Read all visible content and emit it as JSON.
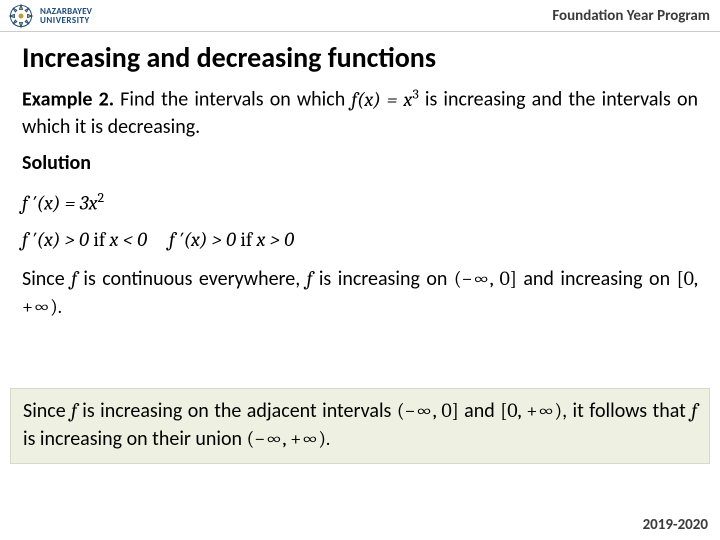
{
  "header": {
    "logo_line1": "NAZARBAYEV",
    "logo_line2": "UNIVERSITY",
    "program": "Foundation Year Program"
  },
  "title": "Increasing and decreasing functions",
  "example": {
    "label": "Example 2.",
    "text_before": " Find the intervals on which ",
    "fx_eq": "f(x) = x",
    "exp": "3",
    "text_after": " is increasing and the intervals on which it is decreasing."
  },
  "solution_label": "Solution",
  "derivative": {
    "lhs": "f ′(x) = 3x",
    "exp": "2"
  },
  "signs": {
    "p1a": "f ′(x) > 0",
    "if1": " if ",
    "p1b": "x < 0",
    "p2a": "f ′(x) > 0",
    "if2": " if ",
    "p2b": "x > 0"
  },
  "since1": {
    "a": "Since ",
    "f1": "f",
    "b": " is continuous everywhere, ",
    "f2": "f",
    "c": " is increasing on ",
    "int1": "(−∞, 0]",
    "d": " and increasing on ",
    "int2": "[0, +∞).",
    "e": ""
  },
  "callout": {
    "a": "Since ",
    "f1": "f",
    "b": " is increasing on the adjacent intervals ",
    "int1": "(−∞, 0]",
    "c": " and ",
    "int2": "[0, +∞)",
    "d": ", it follows that ",
    "f2": "f",
    "e": " is increasing on their union ",
    "int3": "(−∞, +∞)."
  },
  "footer": "2019-2020"
}
